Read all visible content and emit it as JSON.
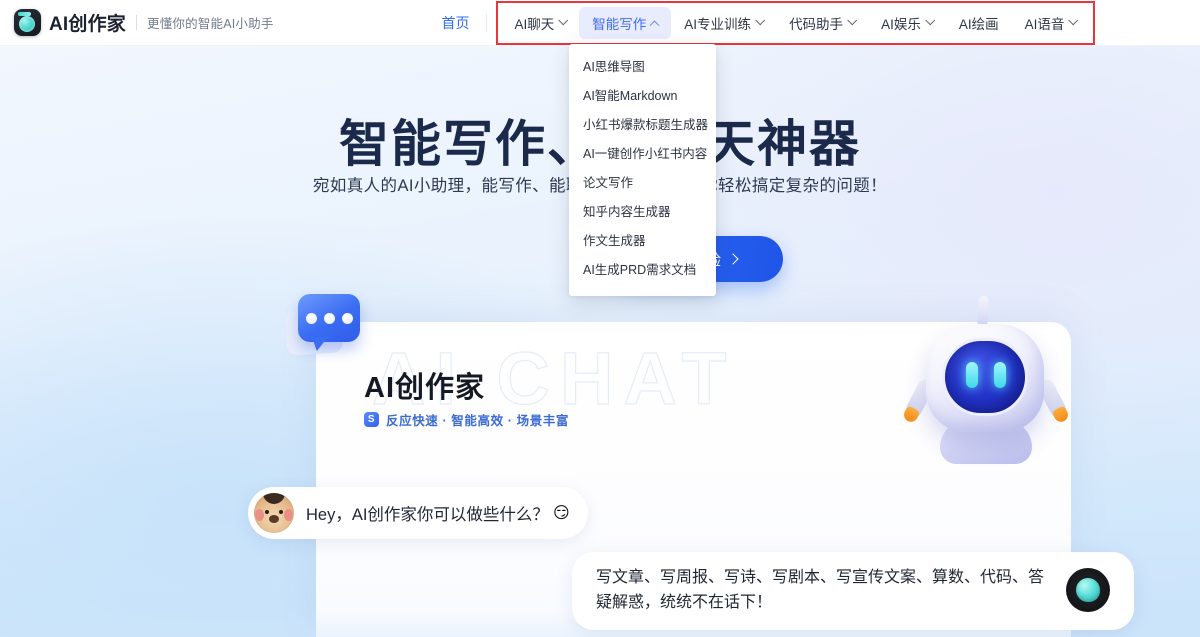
{
  "header": {
    "logo_icon": "app-logo-icon",
    "brand_name": "AI创作家",
    "brand_tagline": "更懂你的智能AI小助手",
    "home_label": "首页",
    "nav_items": [
      {
        "label": "AI聊天",
        "caret": "chevron-down-icon",
        "active": false
      },
      {
        "label": "智能写作",
        "caret": "chevron-up-icon",
        "active": true
      },
      {
        "label": "AI专业训练",
        "caret": "chevron-down-icon",
        "active": false
      },
      {
        "label": "代码助手",
        "caret": "chevron-down-icon",
        "active": false
      },
      {
        "label": "AI娱乐",
        "caret": "chevron-down-icon",
        "active": false
      },
      {
        "label": "AI绘画",
        "caret": "",
        "active": false
      },
      {
        "label": "AI语音",
        "caret": "chevron-down-icon",
        "active": false
      }
    ],
    "annotation_color": "#e8353e",
    "active_item_bg": "#e8ecfd",
    "active_item_color": "#3f6bf5"
  },
  "dropdown": {
    "parent": "智能写作",
    "items": [
      "AI思维导图",
      "AI智能Markdown",
      "小红书爆款标题生成器",
      "AI一键创作小红书内容",
      "论文写作",
      "知乎内容生成器",
      "作文生成器",
      "AI生成PRD需求文档"
    ]
  },
  "hero": {
    "title": "智能写作、AI聊天神器",
    "subtitle": "宛如真人的AI小助理，能写作、能聊天、能绘画，帮你轻松搞定复杂的问题！",
    "cta_label": "立即体验",
    "cta_icon": "arrow-right-icon",
    "cta_color": "#2f6bf5"
  },
  "demo_card": {
    "watermark": "AI CHAT",
    "title": "AI创作家",
    "tagline": "反应快速 · 智能高效 · 场景丰富",
    "badge_icon": "spark-badge-icon",
    "chat_bubble_icon": "chat-bubble-icon",
    "robot_icon": "robot-mascot-icon",
    "messages": [
      {
        "role": "user",
        "avatar_icon": "dog-avatar-icon",
        "text": "Hey，AI创作家你可以做些什么？",
        "emoji": "😏"
      },
      {
        "role": "assistant",
        "avatar_icon": "ai-avatar-icon",
        "text": "写文章、写周报、写诗、写剧本、写宣传文案、算数、代码、答疑解惑，统统不在话下！"
      }
    ]
  }
}
